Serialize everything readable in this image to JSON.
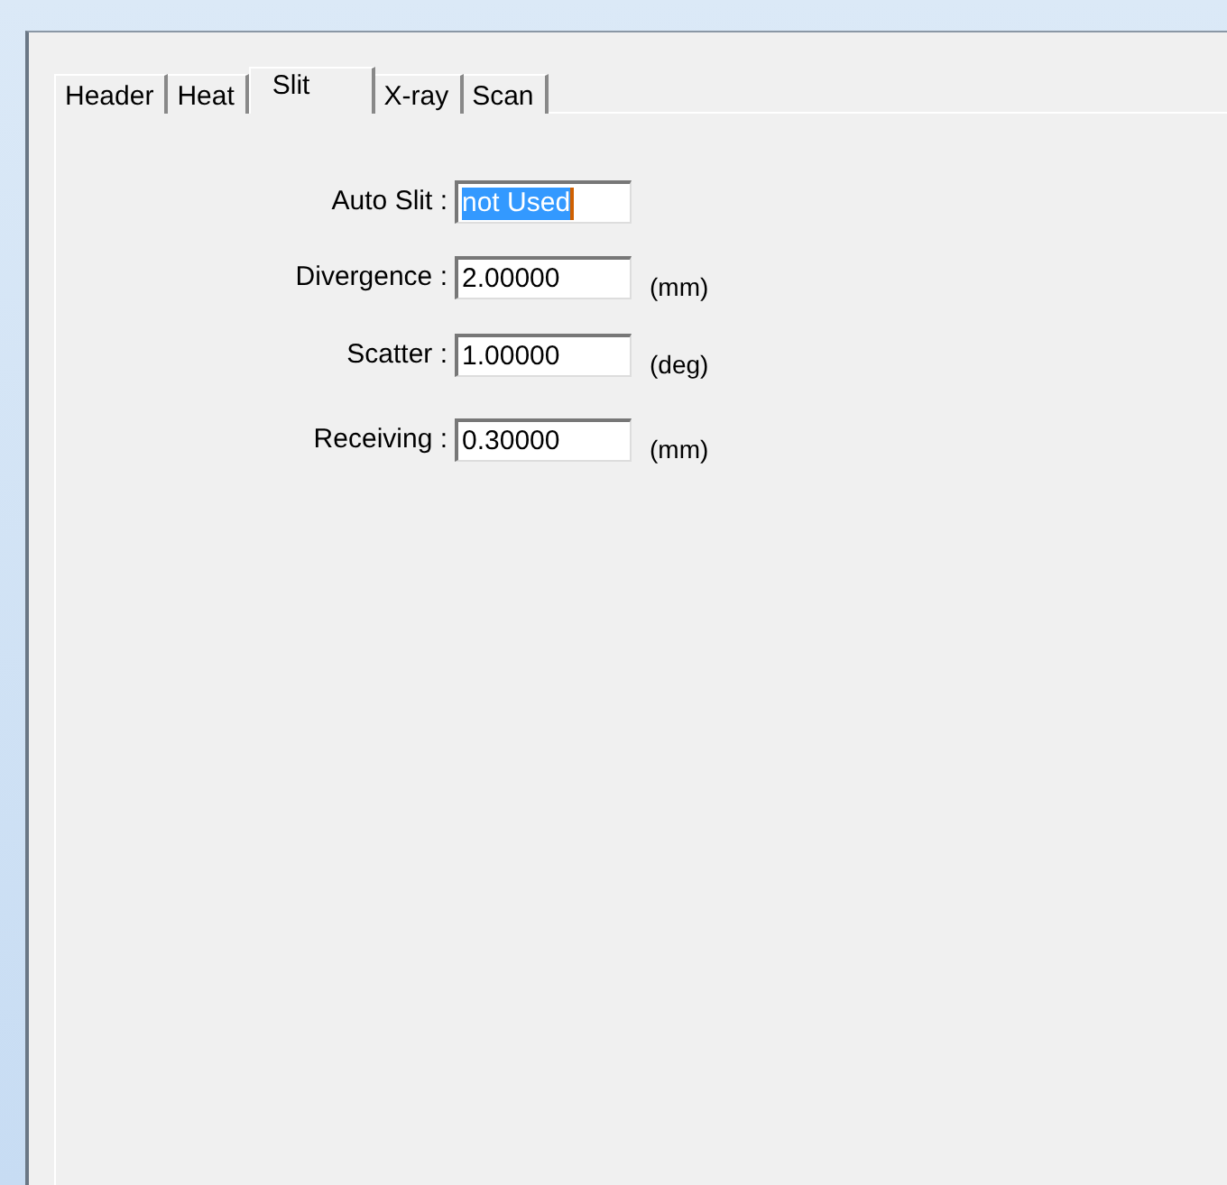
{
  "tabs": [
    {
      "label": "Header",
      "selected": false
    },
    {
      "label": "Heat",
      "selected": false
    },
    {
      "label": "Slit",
      "selected": true
    },
    {
      "label": "X-ray",
      "selected": false
    },
    {
      "label": "Scan",
      "selected": false
    }
  ],
  "fields": [
    {
      "label": "Auto Slit :",
      "value": "not Used",
      "text_selected": true
    },
    {
      "label": "Divergence :",
      "value": "2.00000",
      "unit": "(mm)",
      "text_selected": false
    },
    {
      "label": "Scatter :",
      "value": "1.00000",
      "unit": "(deg)",
      "text_selected": false
    },
    {
      "label": "Receiving :",
      "value": "0.30000",
      "unit": "(mm)",
      "text_selected": false
    }
  ]
}
